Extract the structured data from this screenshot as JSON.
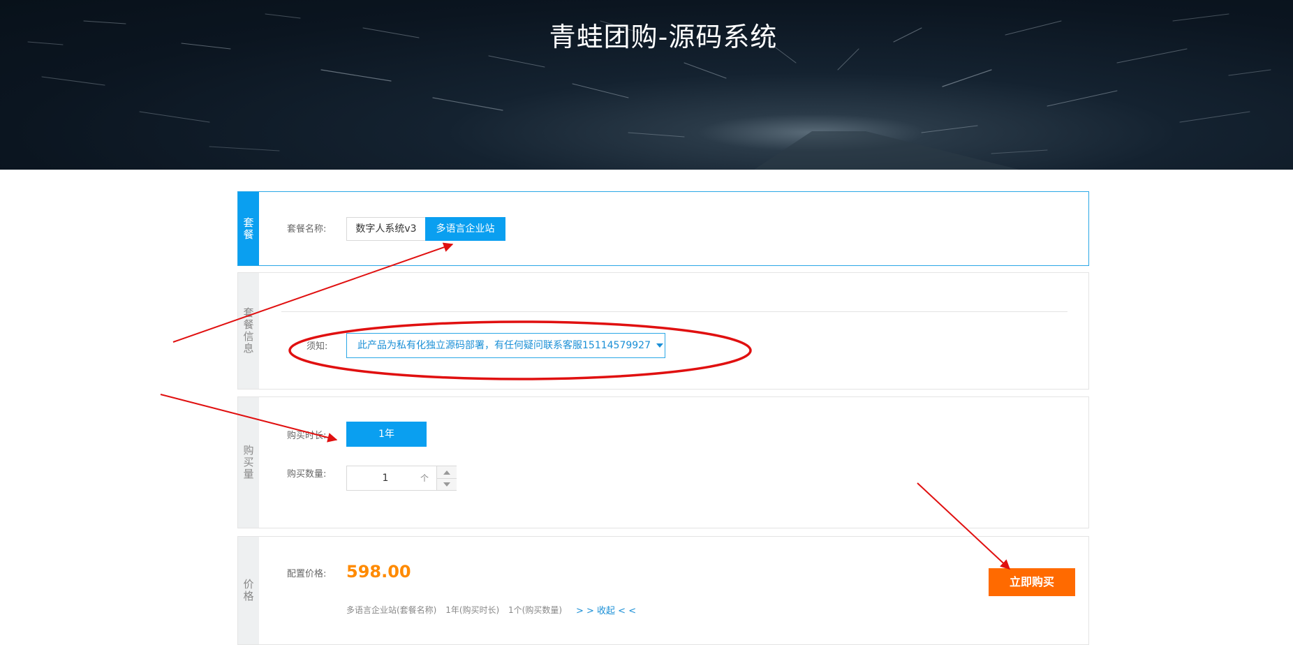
{
  "banner": {
    "title": "青蛙团购-源码系统"
  },
  "package": {
    "tab_label": "套餐",
    "name_label": "套餐名称:",
    "options": [
      "数字人系统v3",
      "多语言企业站"
    ],
    "selected_index": 1
  },
  "package_info": {
    "tab_label": "套餐信息",
    "notice_label": "须知:",
    "notice_text": "此产品为私有化独立源码部署，有任何疑问联系客服15114579927"
  },
  "purchase": {
    "tab_label": "购买量",
    "duration_label": "购买时长:",
    "duration_value": "1年",
    "quantity_label": "购买数量:",
    "quantity_value": "1",
    "quantity_unit": "个"
  },
  "price": {
    "tab_label": "价格",
    "price_label": "配置价格:",
    "price_value": "598.00",
    "summary": [
      "多语言企业站(套餐名称)",
      "1年(购买时长)",
      "1个(购买数量)"
    ],
    "collapse_link": "> > 收起 < <",
    "buy_button": "立即购买"
  },
  "colors": {
    "accent": "#0a9ff0",
    "price": "#ff8a00",
    "buy": "#ff6a00",
    "annotation": "#e01010"
  }
}
